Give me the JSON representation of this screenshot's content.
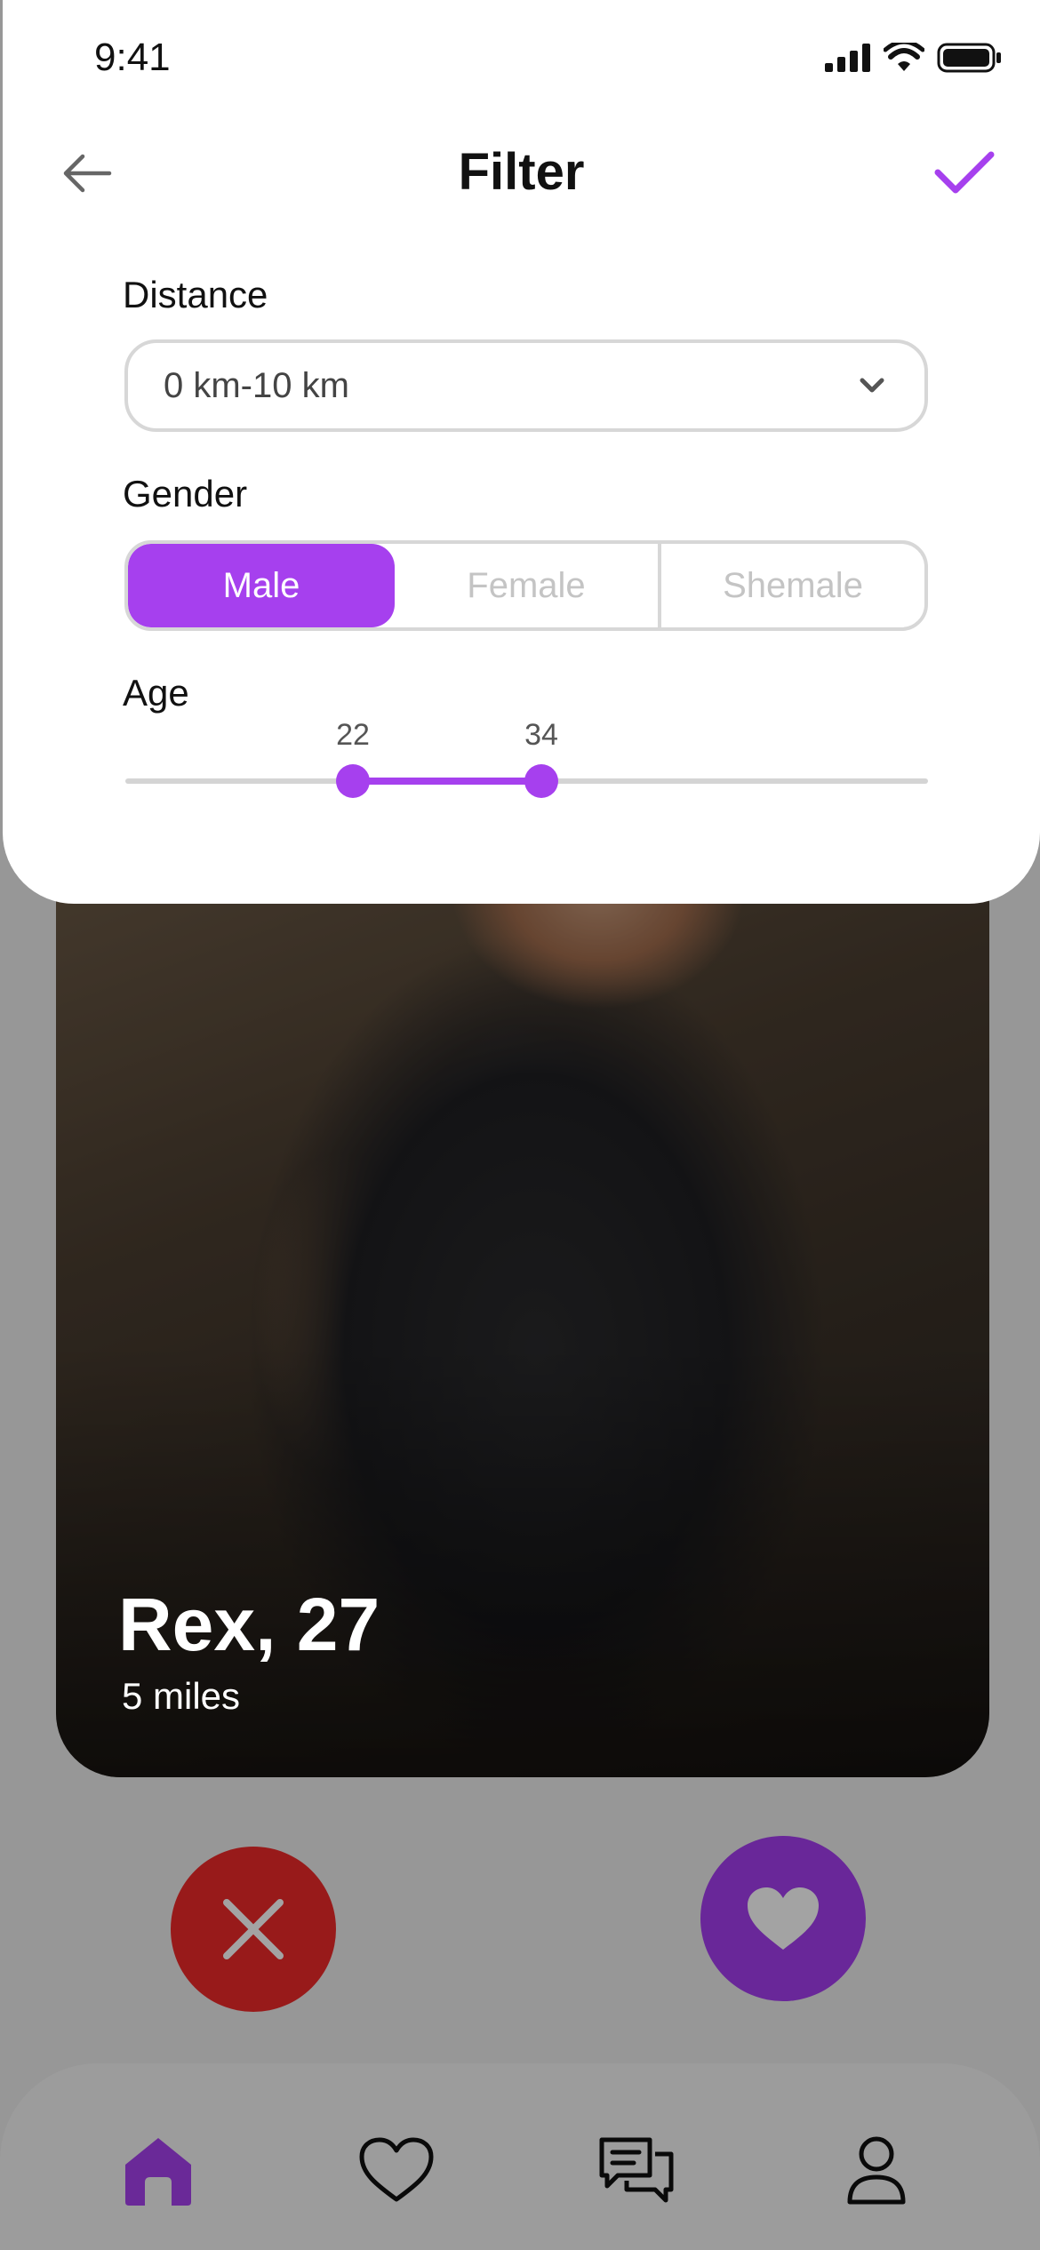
{
  "status_bar": {
    "time": "9:41",
    "icons": [
      "signal-icon",
      "wifi-icon",
      "battery-icon"
    ]
  },
  "filter": {
    "title": "Filter",
    "back_icon": "arrow-left-icon",
    "confirm_icon": "checkmark-icon",
    "distance": {
      "label": "Distance",
      "value": "0 km-10 km"
    },
    "gender": {
      "label": "Gender",
      "options": [
        "Male",
        "Female",
        "Shemale"
      ],
      "selected": "Male"
    },
    "age": {
      "label": "Age",
      "min_value": "22",
      "max_value": "34"
    }
  },
  "profile": {
    "name_age": "Rex, 27",
    "distance": "5 miles"
  },
  "actions": {
    "reject_icon": "close-icon",
    "like_icon": "heart-icon"
  },
  "bottom_nav": {
    "items": [
      "home-icon",
      "heart-outline-icon",
      "chat-icon",
      "profile-icon"
    ],
    "active": "home-icon"
  },
  "colors": {
    "accent": "#a640ee",
    "reject": "#ee2a2a"
  }
}
